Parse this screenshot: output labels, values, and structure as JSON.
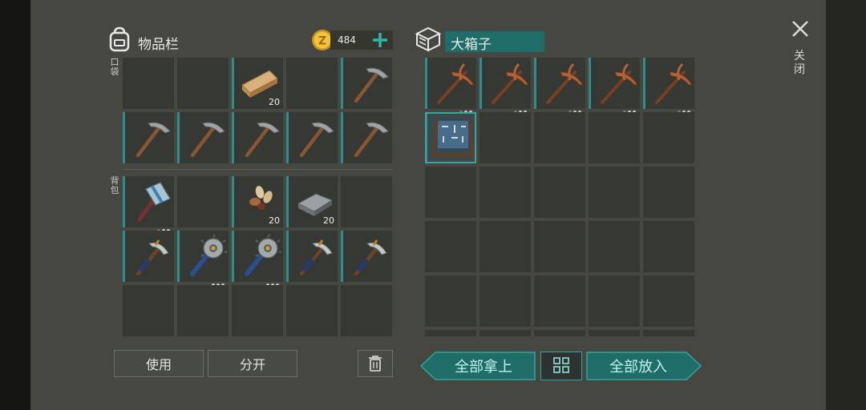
{
  "inventory": {
    "title": "物品栏",
    "coins": "484",
    "pocket_label": "口袋",
    "backpack_label": "背包",
    "pocket_slots": [
      {
        "item": "empty"
      },
      {
        "item": "empty"
      },
      {
        "item": "wood-plank",
        "qty": "20"
      },
      {
        "item": "empty"
      },
      {
        "item": "pickaxe"
      },
      {
        "item": "pickaxe"
      },
      {
        "item": "pickaxe"
      },
      {
        "item": "pickaxe"
      },
      {
        "item": "pickaxe"
      },
      {
        "item": "pickaxe"
      }
    ],
    "backpack_slots": [
      {
        "item": "sledgehammer",
        "durability": 2
      },
      {
        "item": "empty"
      },
      {
        "item": "seeds",
        "qty": "20"
      },
      {
        "item": "iron-ingot",
        "qty": "20"
      },
      {
        "item": "empty"
      },
      {
        "item": "hatchet-pick"
      },
      {
        "item": "saw-mace",
        "durability": 3
      },
      {
        "item": "saw-mace",
        "durability": 3
      },
      {
        "item": "hatchet-pick"
      },
      {
        "item": "hatchet-pick"
      },
      {
        "item": "empty"
      },
      {
        "item": "empty"
      },
      {
        "item": "empty"
      },
      {
        "item": "empty"
      },
      {
        "item": "empty"
      }
    ],
    "use_label": "使用",
    "split_label": "分开"
  },
  "chest": {
    "title": "大箱子",
    "slots": [
      {
        "item": "copper-pickaxe",
        "durability": 2
      },
      {
        "item": "copper-pickaxe",
        "durability": 2
      },
      {
        "item": "copper-pickaxe",
        "durability": 2
      },
      {
        "item": "copper-pickaxe",
        "durability": 2
      },
      {
        "item": "copper-pickaxe",
        "durability": 2
      },
      {
        "item": "tool-rack",
        "selected": true
      }
    ],
    "take_all_label": "全部拿上",
    "put_all_label": "全部放入"
  },
  "close_label": "关闭",
  "colors": {
    "accent": "#2d8f8d",
    "button_fill": "#1f6d69",
    "button_text": "#bff2ee",
    "coin": "#e0b128"
  }
}
